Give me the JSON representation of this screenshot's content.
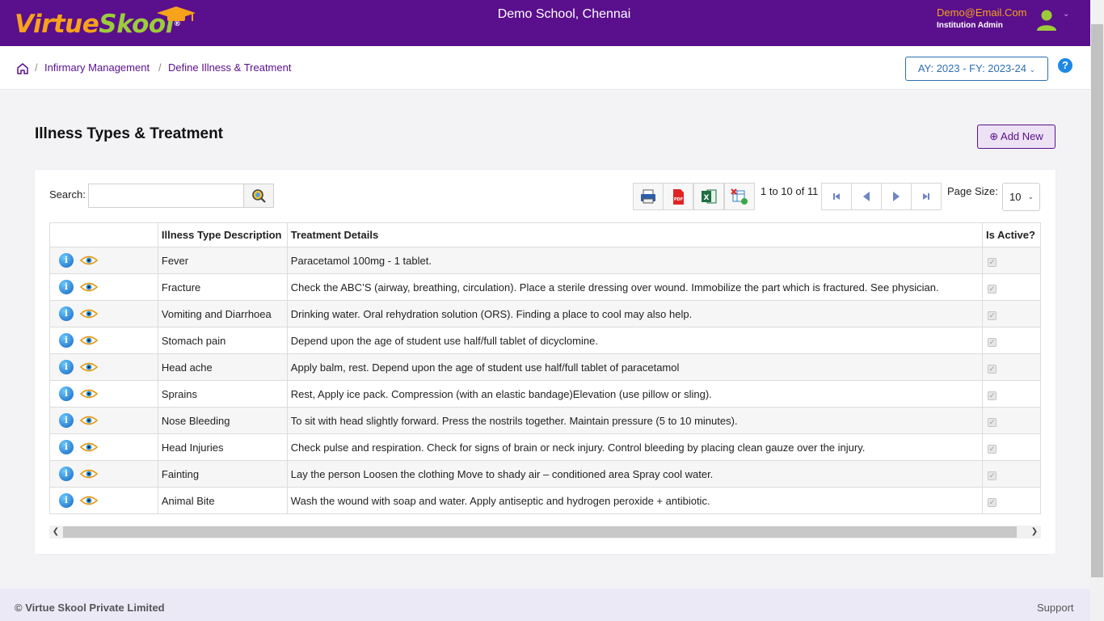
{
  "header": {
    "logo_main": "Virtue",
    "logo_accent": "Skool",
    "logo_mark": "®",
    "school_name": "Demo School, Chennai",
    "user_email": "Demo@Email.Com",
    "user_role": "Institution Admin"
  },
  "breadcrumb": {
    "items": [
      "Infirmary Management",
      "Define Illness & Treatment"
    ]
  },
  "academic_year": "AY: 2023 - FY: 2023-24",
  "page": {
    "title": "Illness Types & Treatment",
    "add_new_label": "Add New"
  },
  "toolbar": {
    "search_label": "Search:",
    "search_value": "",
    "pager_info": "1 to 10 of 11",
    "page_size_label": "Page Size:",
    "page_size": "10"
  },
  "table": {
    "columns": [
      "",
      "Illness Type Description",
      "Treatment Details",
      "Is Active?"
    ],
    "rows": [
      {
        "illness": "Fever",
        "treatment": "Paracetamol 100mg - 1 tablet.",
        "active": true
      },
      {
        "illness": "Fracture",
        "treatment": "Check the ABC’S (airway, breathing, circulation). Place a sterile dressing over wound. Immobilize the part which is fractured. See physician.",
        "active": true
      },
      {
        "illness": "Vomiting and Diarrhoea",
        "treatment": "Drinking water. Oral rehydration solution (ORS). Finding a place to cool may also help.",
        "active": true
      },
      {
        "illness": "Stomach pain",
        "treatment": "Depend upon the age of student use half/full tablet of dicyclomine.",
        "active": true
      },
      {
        "illness": "Head ache",
        "treatment": "Apply balm, rest. Depend upon the age of student use half/full tablet of paracetamol",
        "active": true
      },
      {
        "illness": "Sprains",
        "treatment": "Rest, Apply ice pack. Compression (with an elastic bandage)Elevation (use pillow or sling).",
        "active": true
      },
      {
        "illness": "Nose Bleeding",
        "treatment": "To sit with head slightly forward. Press the nostrils together. Maintain pressure (5 to 10 minutes).",
        "active": true
      },
      {
        "illness": "Head Injuries",
        "treatment": "Check pulse and respiration. Check for signs of brain or neck injury. Control bleeding by placing clean gauze over the injury.",
        "active": true
      },
      {
        "illness": "Fainting",
        "treatment": "Lay the person Loosen the clothing Move to shady air – conditioned area Spray cool water.",
        "active": true
      },
      {
        "illness": "Animal Bite",
        "treatment": "Wash the wound with soap and water. Apply antiseptic and hydrogen peroxide + antibiotic.",
        "active": true
      }
    ]
  },
  "footer": {
    "copyright": "© Virtue Skool Private Limited",
    "support": "Support"
  },
  "colors": {
    "brand_purple": "#5a0f8c",
    "logo_orange": "#f7a21b",
    "logo_green": "#9ccc3c",
    "link_blue": "#2c6fb3"
  }
}
